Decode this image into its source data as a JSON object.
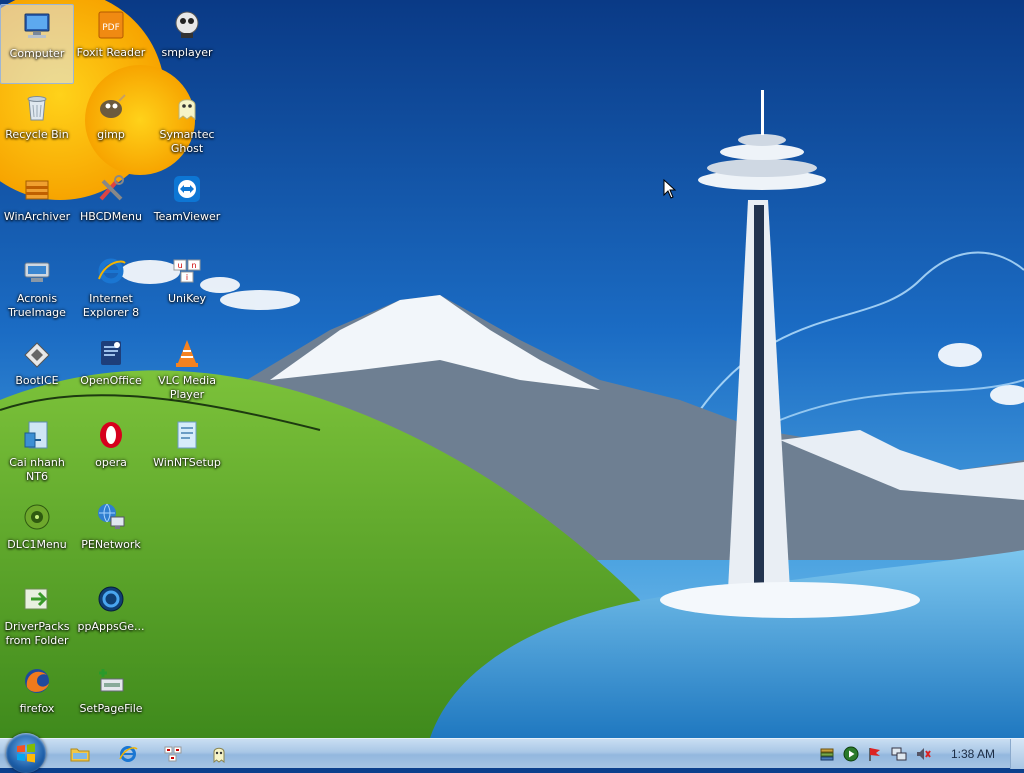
{
  "desktop": {
    "icons": [
      {
        "label": "Computer",
        "icon": "computer-icon",
        "selected": true
      },
      {
        "label": "Foxit Reader",
        "icon": "pdf-icon"
      },
      {
        "label": "smplayer",
        "icon": "smplayer-icon"
      },
      {
        "label": "Recycle Bin",
        "icon": "recycle-bin-icon"
      },
      {
        "label": "gimp",
        "icon": "gimp-icon"
      },
      {
        "label": "Symantec Ghost",
        "icon": "ghost-icon"
      },
      {
        "label": "WinArchiver",
        "icon": "archiver-icon"
      },
      {
        "label": "HBCDMenu",
        "icon": "tools-icon"
      },
      {
        "label": "TeamViewer",
        "icon": "teamviewer-icon"
      },
      {
        "label": "Acronis TrueImage",
        "icon": "acronis-icon"
      },
      {
        "label": "Internet Explorer 8",
        "icon": "internet-explorer-icon"
      },
      {
        "label": "UniKey",
        "icon": "unikey-icon"
      },
      {
        "label": "BootICE",
        "icon": "bootice-icon"
      },
      {
        "label": "OpenOffice",
        "icon": "openoffice-icon"
      },
      {
        "label": "VLC Media Player",
        "icon": "vlc-icon"
      },
      {
        "label": "Cai nhanh NT6",
        "icon": "installer-icon"
      },
      {
        "label": "opera",
        "icon": "opera-icon"
      },
      {
        "label": "WinNTSetup",
        "icon": "winntsetup-icon"
      },
      {
        "label": "DLC1Menu",
        "icon": "dlc-icon"
      },
      {
        "label": "PENetwork",
        "icon": "network-icon"
      },
      {
        "label": "DriverPacks from Folder",
        "icon": "driverpacks-icon"
      },
      {
        "label": "ppAppsGe...",
        "icon": "ppapps-icon"
      },
      {
        "label": "firefox",
        "icon": "firefox-icon"
      },
      {
        "label": "SetPageFile",
        "icon": "setpagefile-icon"
      }
    ]
  },
  "taskbar": {
    "start_icon": "windows-logo-icon",
    "pinned": [
      {
        "icon": "explorer-folder-icon"
      },
      {
        "icon": "internet-explorer-icon"
      },
      {
        "icon": "unikey-icon"
      },
      {
        "icon": "ghost-icon"
      }
    ],
    "tray": [
      {
        "icon": "stack-icon"
      },
      {
        "icon": "media-play-icon"
      },
      {
        "icon": "flag-icon"
      },
      {
        "icon": "network-icon"
      },
      {
        "icon": "volume-muted-icon"
      }
    ],
    "clock": "1:38 AM"
  },
  "colors": {
    "sky_top": "#0b3f8c",
    "hill_green": "#5aa22a",
    "lake_blue": "#2f8fd0",
    "taskbar": "#a9c7e6"
  }
}
